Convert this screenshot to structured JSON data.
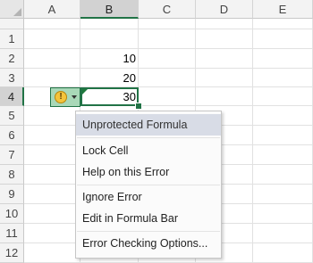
{
  "columns": [
    "A",
    "B",
    "C",
    "D",
    "E"
  ],
  "rows": [
    "1",
    "2",
    "3",
    "4",
    "5",
    "6",
    "7",
    "8",
    "9",
    "10",
    "11",
    "12"
  ],
  "selected_column": "B",
  "selected_row": "4",
  "cells": {
    "B2": "10",
    "B3": "20",
    "B4": "30"
  },
  "error_button": {
    "icon": "warning-icon",
    "symbol": "!"
  },
  "context_menu": {
    "header": "Unprotected Formula",
    "items": {
      "lock_cell": "Lock Cell",
      "help_error": "Help on this Error",
      "ignore_error": "Ignore Error",
      "edit_formula_bar": "Edit in Formula Bar",
      "checking_options": "Error Checking Options..."
    }
  },
  "colors": {
    "accent": "#217346",
    "error_button_bg": "#a9d8b8",
    "menu_hover": "#d8dce6"
  }
}
